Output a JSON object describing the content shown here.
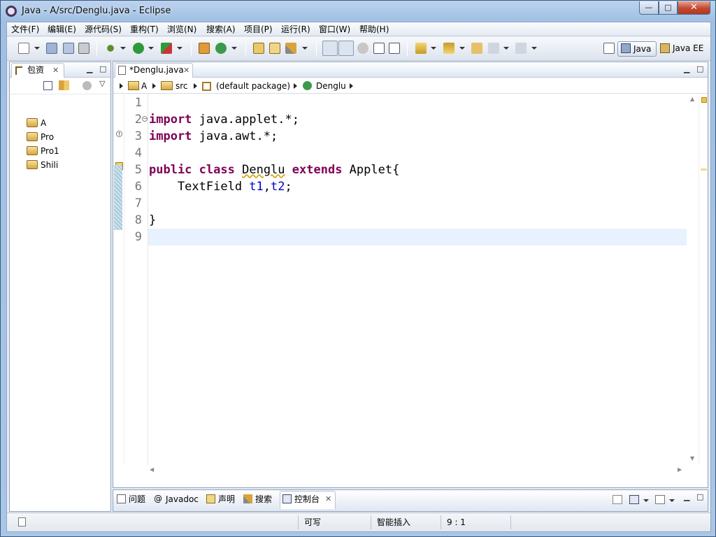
{
  "window": {
    "title": "Java  -  A/src/Denglu.java  -  Eclipse",
    "min": "—",
    "max": "□",
    "close": "✕"
  },
  "menu": [
    "文件(F)",
    "编辑(E)",
    "源代码(S)",
    "重构(T)",
    "浏览(N)",
    "搜索(A)",
    "项目(P)",
    "运行(R)",
    "窗口(W)",
    "帮助(H)"
  ],
  "perspectives": {
    "java": "Java",
    "javaee": "Java EE"
  },
  "package_explorer": {
    "tab_label": "包资",
    "projects": [
      "A",
      "Pro",
      "Pro1",
      "Shili"
    ]
  },
  "editor": {
    "tab_label": "*Denglu.java",
    "breadcrumb": [
      "A",
      "src",
      "(default package)",
      "Denglu"
    ],
    "line_numbers": [
      "1",
      "2",
      "3",
      "4",
      "5",
      "6",
      "7",
      "8",
      "9"
    ],
    "code": {
      "l2_kw": "import",
      "l2_rest": " java.applet.*;",
      "l3_kw": "import",
      "l3_rest": " java.awt.*;",
      "l5_kw1": "public",
      "l5_kw2": "class",
      "l5_name": "Denglu",
      "l5_kw3": "extends",
      "l5_rest": " Applet{",
      "l6_type": "    TextField ",
      "l6_f1": "t1",
      "l6_comma": ",",
      "l6_f2": "t2",
      "l6_end": ";",
      "l8": "}"
    }
  },
  "bottom_tabs": [
    "问题",
    "Javadoc",
    "声明",
    "搜索",
    "控制台"
  ],
  "status": {
    "writable": "可写",
    "insert_mode": "智能插入",
    "position": "9 : 1"
  },
  "colors": {
    "keyword": "#7f0055",
    "field": "#0000c0",
    "current_line": "#e8f2fe"
  }
}
